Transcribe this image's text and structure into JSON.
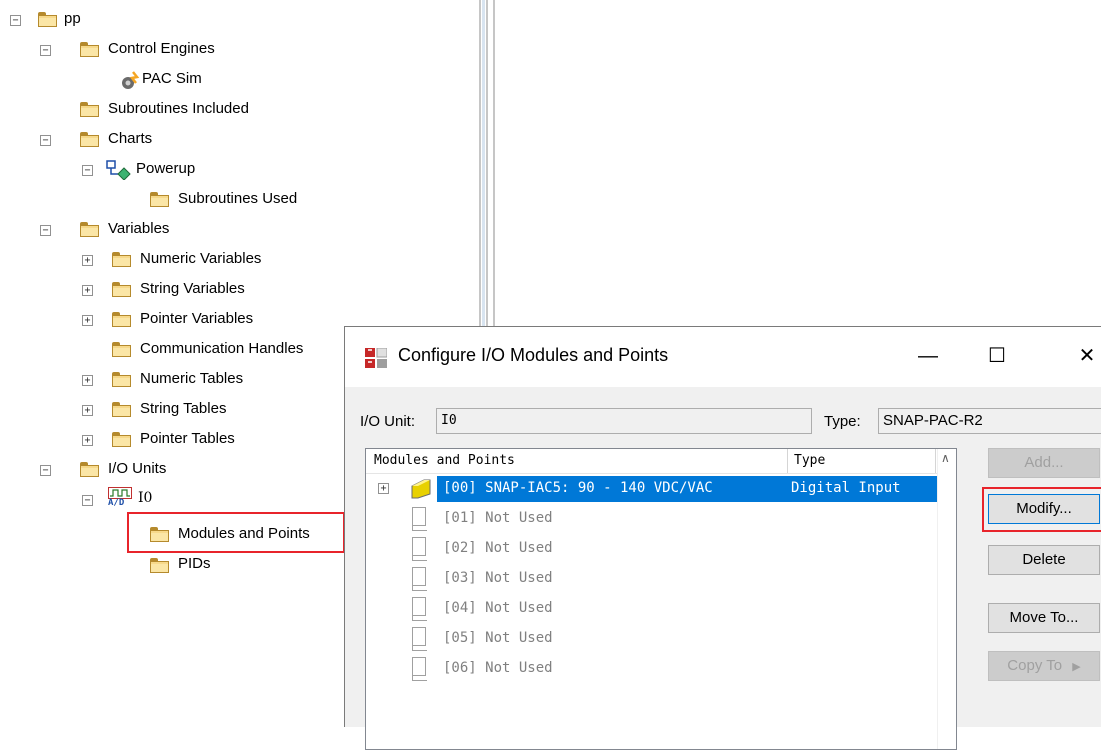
{
  "tree": {
    "root": "pp",
    "control_engines": "Control Engines",
    "pac_sim": "PAC Sim",
    "subroutines_included": "Subroutines Included",
    "charts": "Charts",
    "powerup": "Powerup",
    "subroutines_used": "Subroutines Used",
    "variables": "Variables",
    "numeric_variables": "Numeric Variables",
    "string_variables": "String Variables",
    "pointer_variables": "Pointer Variables",
    "communication_handles": "Communication Handles",
    "numeric_tables": "Numeric Tables",
    "string_tables": "String Tables",
    "pointer_tables": "Pointer Tables",
    "io_units": "I/O Units",
    "io_unit_name": "I0",
    "io_icon_text": "A/D",
    "modules_and_points": "Modules and Points",
    "pids": "PIDs"
  },
  "dialog": {
    "title": "Configure I/O Modules and Points",
    "minimize": "—",
    "maximize": "☐",
    "close": "✕",
    "io_unit_label": "I/O Unit:",
    "io_unit_value": "I0",
    "type_label": "Type:",
    "type_value": "SNAP-PAC-R2",
    "columns": {
      "modules": "Modules and Points",
      "type": "Type"
    },
    "rows": [
      {
        "module": "[00] SNAP-IAC5: 90 - 140 VDC/VAC",
        "type": "Digital Input"
      },
      {
        "module": "[01] Not Used",
        "type": ""
      },
      {
        "module": "[02] Not Used",
        "type": ""
      },
      {
        "module": "[03] Not Used",
        "type": ""
      },
      {
        "module": "[04] Not Used",
        "type": ""
      },
      {
        "module": "[05] Not Used",
        "type": ""
      },
      {
        "module": "[06] Not Used",
        "type": ""
      }
    ],
    "buttons": {
      "add": "Add...",
      "modify": "Modify...",
      "delete": "Delete",
      "move_to": "Move To...",
      "copy_to": "Copy To"
    }
  },
  "colors": {
    "selection": "#0078d7",
    "highlight": "#e8242b",
    "folder": "#f7d98b"
  }
}
